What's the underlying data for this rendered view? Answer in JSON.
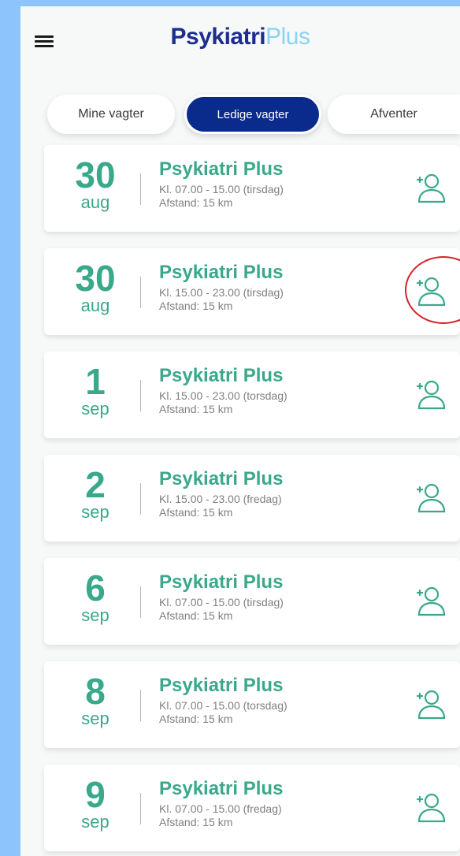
{
  "header": {
    "menu_icon": "hamburger-menu-icon",
    "logo_strong": "Psykiatri",
    "logo_light": "Plus"
  },
  "tabs": [
    {
      "label": "Mine vagter",
      "active": false
    },
    {
      "label": "Ledige vagter",
      "active": true
    },
    {
      "label": "Afventer",
      "active": false
    }
  ],
  "colors": {
    "brand_navy": "#1c2e8e",
    "brand_light": "#8bd3f3",
    "accent_green": "#3aa88a",
    "tab_active": "#0a2a8c",
    "highlight_red": "#d81f2a"
  },
  "shifts": [
    {
      "day": "30",
      "month": "aug",
      "title": "Psykiatri Plus",
      "time": "Kl. 07.00 - 15.00  (tirsdag)",
      "distance": "Afstand: 15 km",
      "icon": "add-user-icon"
    },
    {
      "day": "30",
      "month": "aug",
      "title": "Psykiatri Plus",
      "time": "Kl. 15.00 - 23.00  (tirsdag)",
      "distance": "Afstand: 15 km",
      "icon": "add-user-icon",
      "highlighted": true
    },
    {
      "day": "1",
      "month": "sep",
      "title": "Psykiatri Plus",
      "time": "Kl. 15.00 - 23.00  (torsdag)",
      "distance": "Afstand: 15 km",
      "icon": "add-user-icon"
    },
    {
      "day": "2",
      "month": "sep",
      "title": "Psykiatri Plus",
      "time": "Kl. 15.00 - 23.00  (fredag)",
      "distance": "Afstand: 15 km",
      "icon": "add-user-icon"
    },
    {
      "day": "6",
      "month": "sep",
      "title": "Psykiatri Plus",
      "time": "Kl. 07.00 - 15.00  (tirsdag)",
      "distance": "Afstand: 15 km",
      "icon": "add-user-icon"
    },
    {
      "day": "8",
      "month": "sep",
      "title": "Psykiatri Plus",
      "time": "Kl. 07.00 - 15.00  (torsdag)",
      "distance": "Afstand: 15 km",
      "icon": "add-user-icon"
    },
    {
      "day": "9",
      "month": "sep",
      "title": "Psykiatri Plus",
      "time": "Kl. 07.00 - 15.00  (fredag)",
      "distance": "Afstand: 15 km",
      "icon": "add-user-icon"
    }
  ]
}
